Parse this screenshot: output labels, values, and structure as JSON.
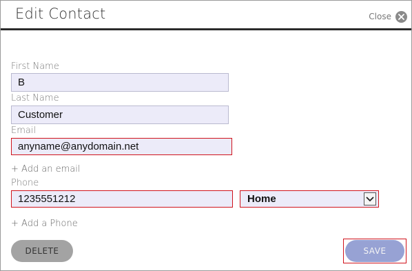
{
  "header": {
    "title": "Edit Contact",
    "close_label": "Close"
  },
  "form": {
    "first_name": {
      "label": "First Name",
      "value": "B"
    },
    "last_name": {
      "label": "Last Name",
      "value": "Customer"
    },
    "email": {
      "label": "Email",
      "value": "anyname@anydomain.net"
    },
    "add_email_label": "+ Add an email",
    "phone": {
      "label": "Phone",
      "value": "1235551212",
      "type_selected": "Home"
    },
    "add_phone_label": "+ Add a Phone"
  },
  "actions": {
    "delete_label": "DELETE",
    "save_label": "SAVE"
  },
  "colors": {
    "input_bg": "#ecebf9",
    "error_border": "#d0121b",
    "save_bg": "#97a2d4",
    "delete_bg": "#a3a3a3"
  }
}
